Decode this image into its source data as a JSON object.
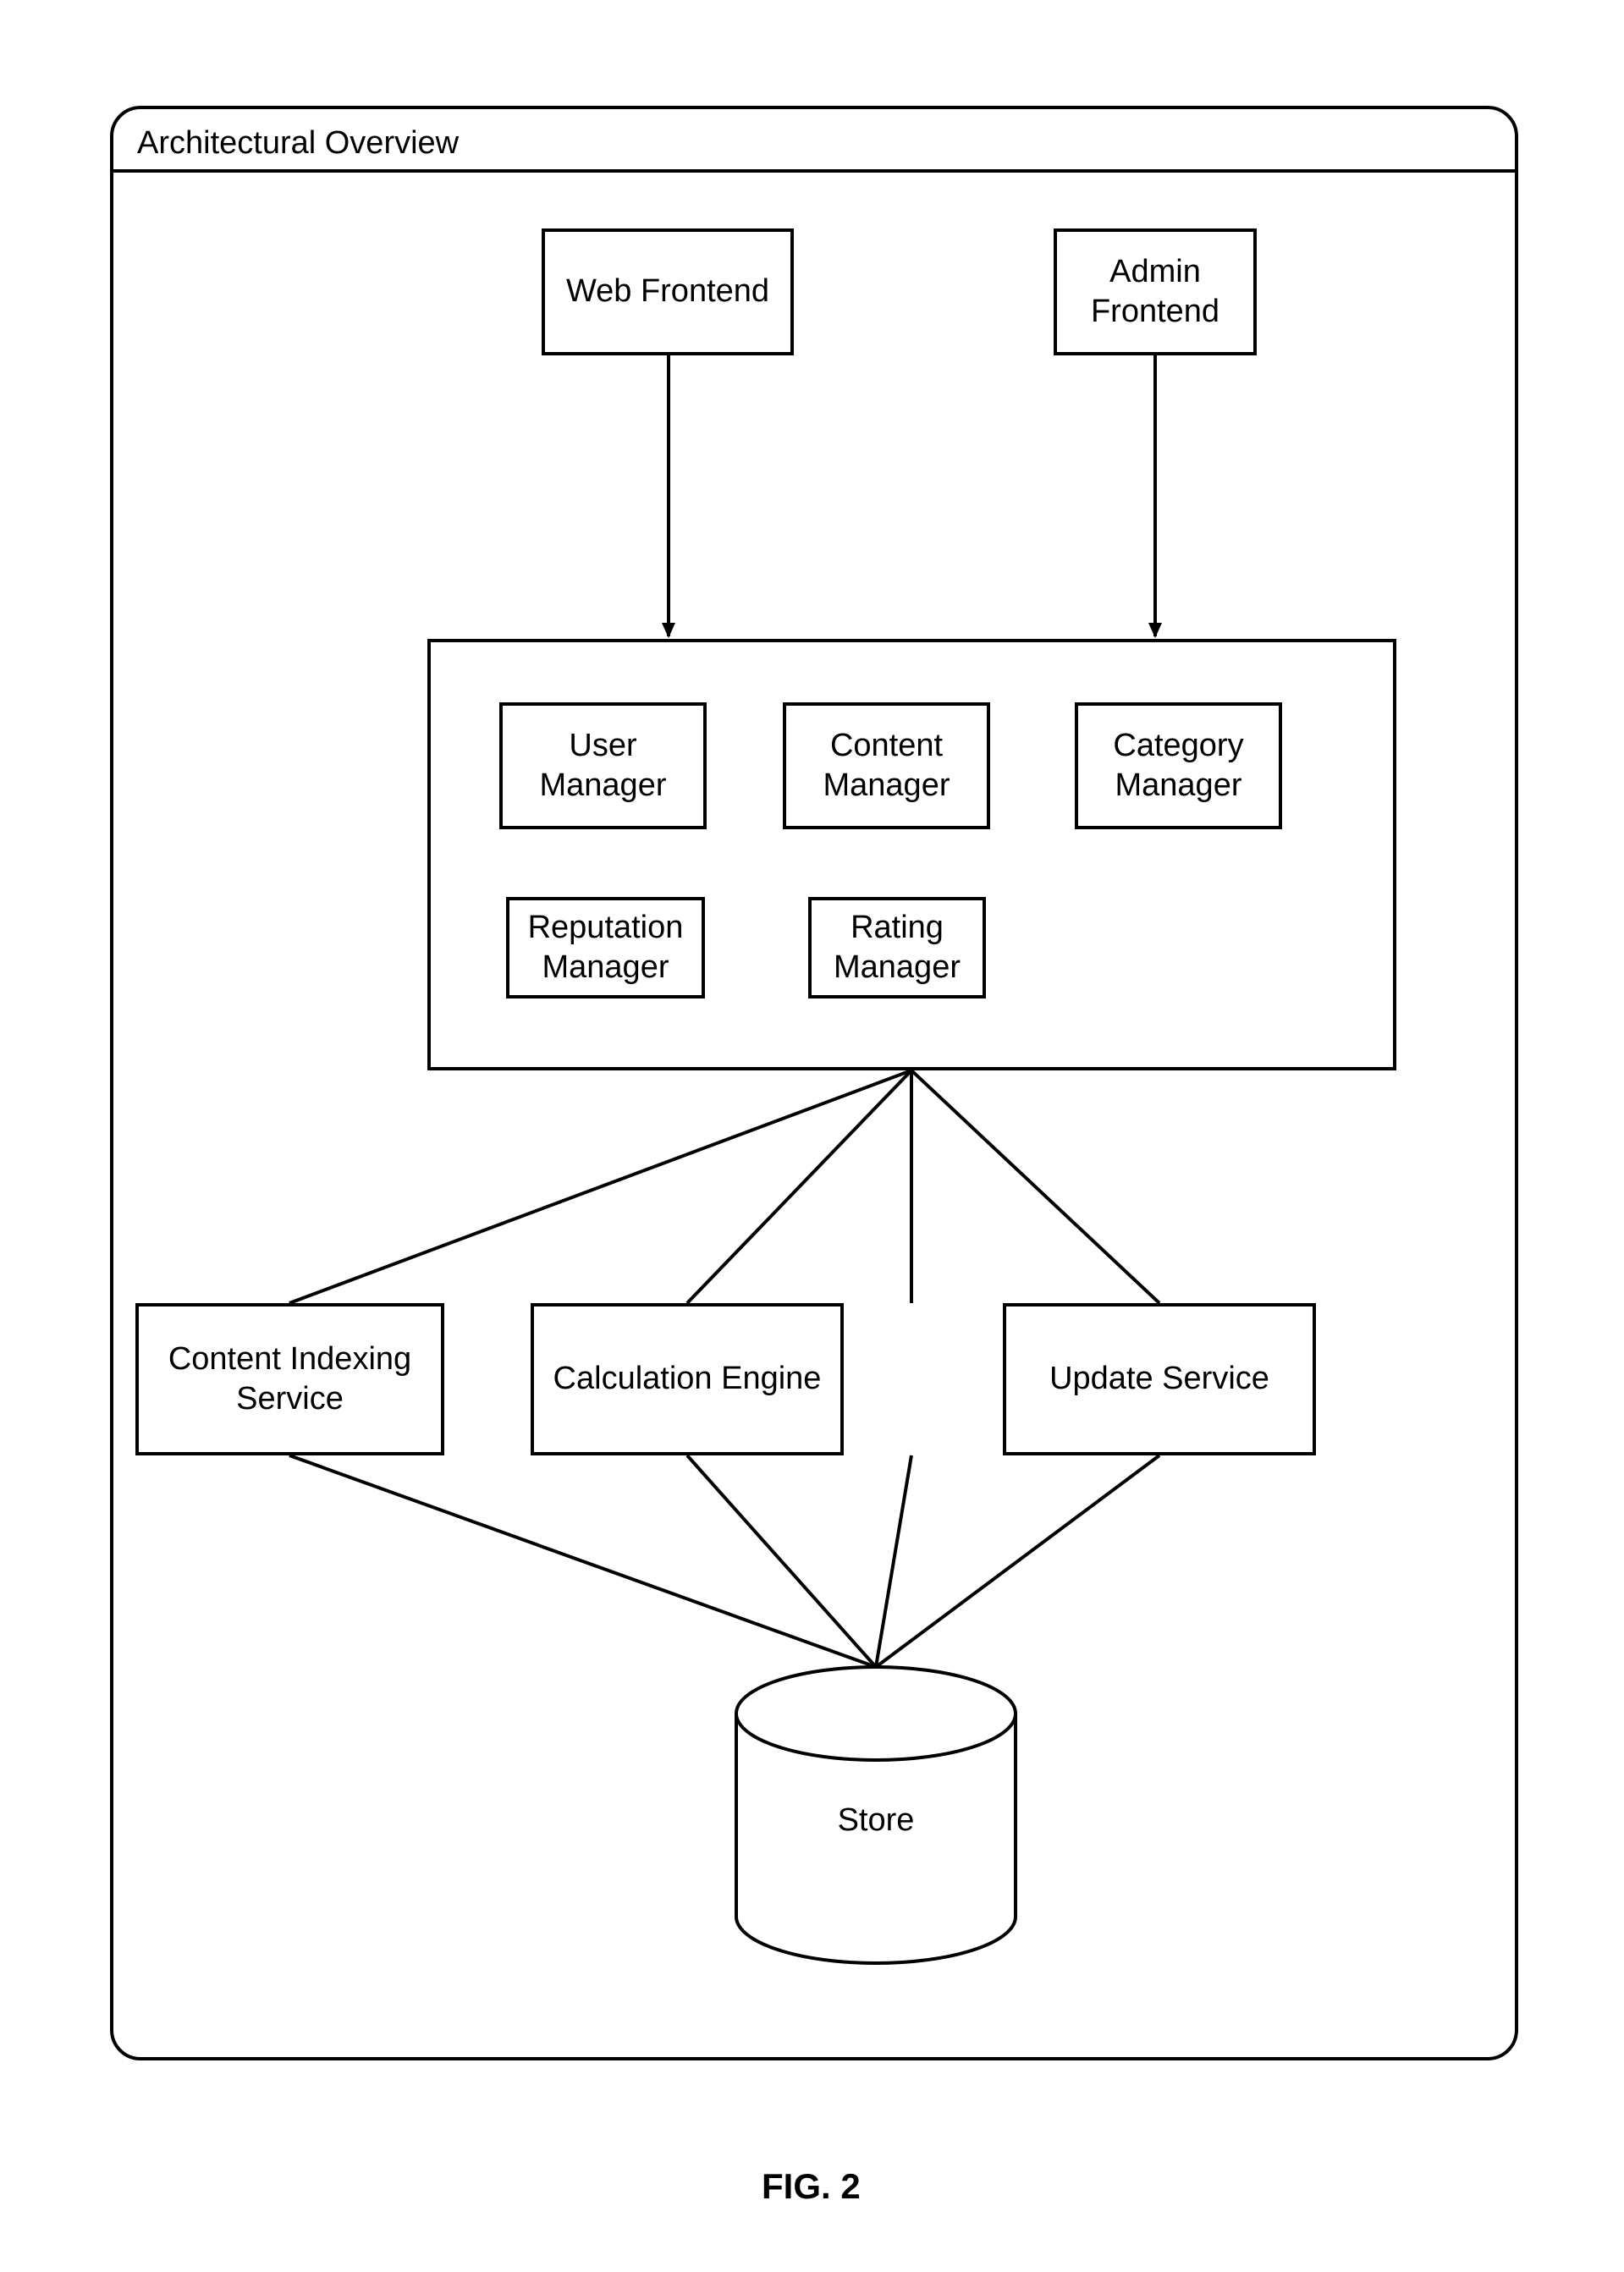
{
  "panel": {
    "title": "Architectural Overview"
  },
  "row1": {
    "web_frontend": "Web Frontend",
    "admin_frontend": "Admin\nFrontend"
  },
  "managers": {
    "user": "User\nManager",
    "content": "Content\nManager",
    "category": "Category\nManager",
    "reputation": "Reputation\nManager",
    "rating": "Rating\nManager"
  },
  "services": {
    "indexing": "Content Indexing\nService",
    "calculation": "Calculation Engine",
    "update": "Update Service"
  },
  "store": "Store",
  "figure_caption": "FIG. 2"
}
